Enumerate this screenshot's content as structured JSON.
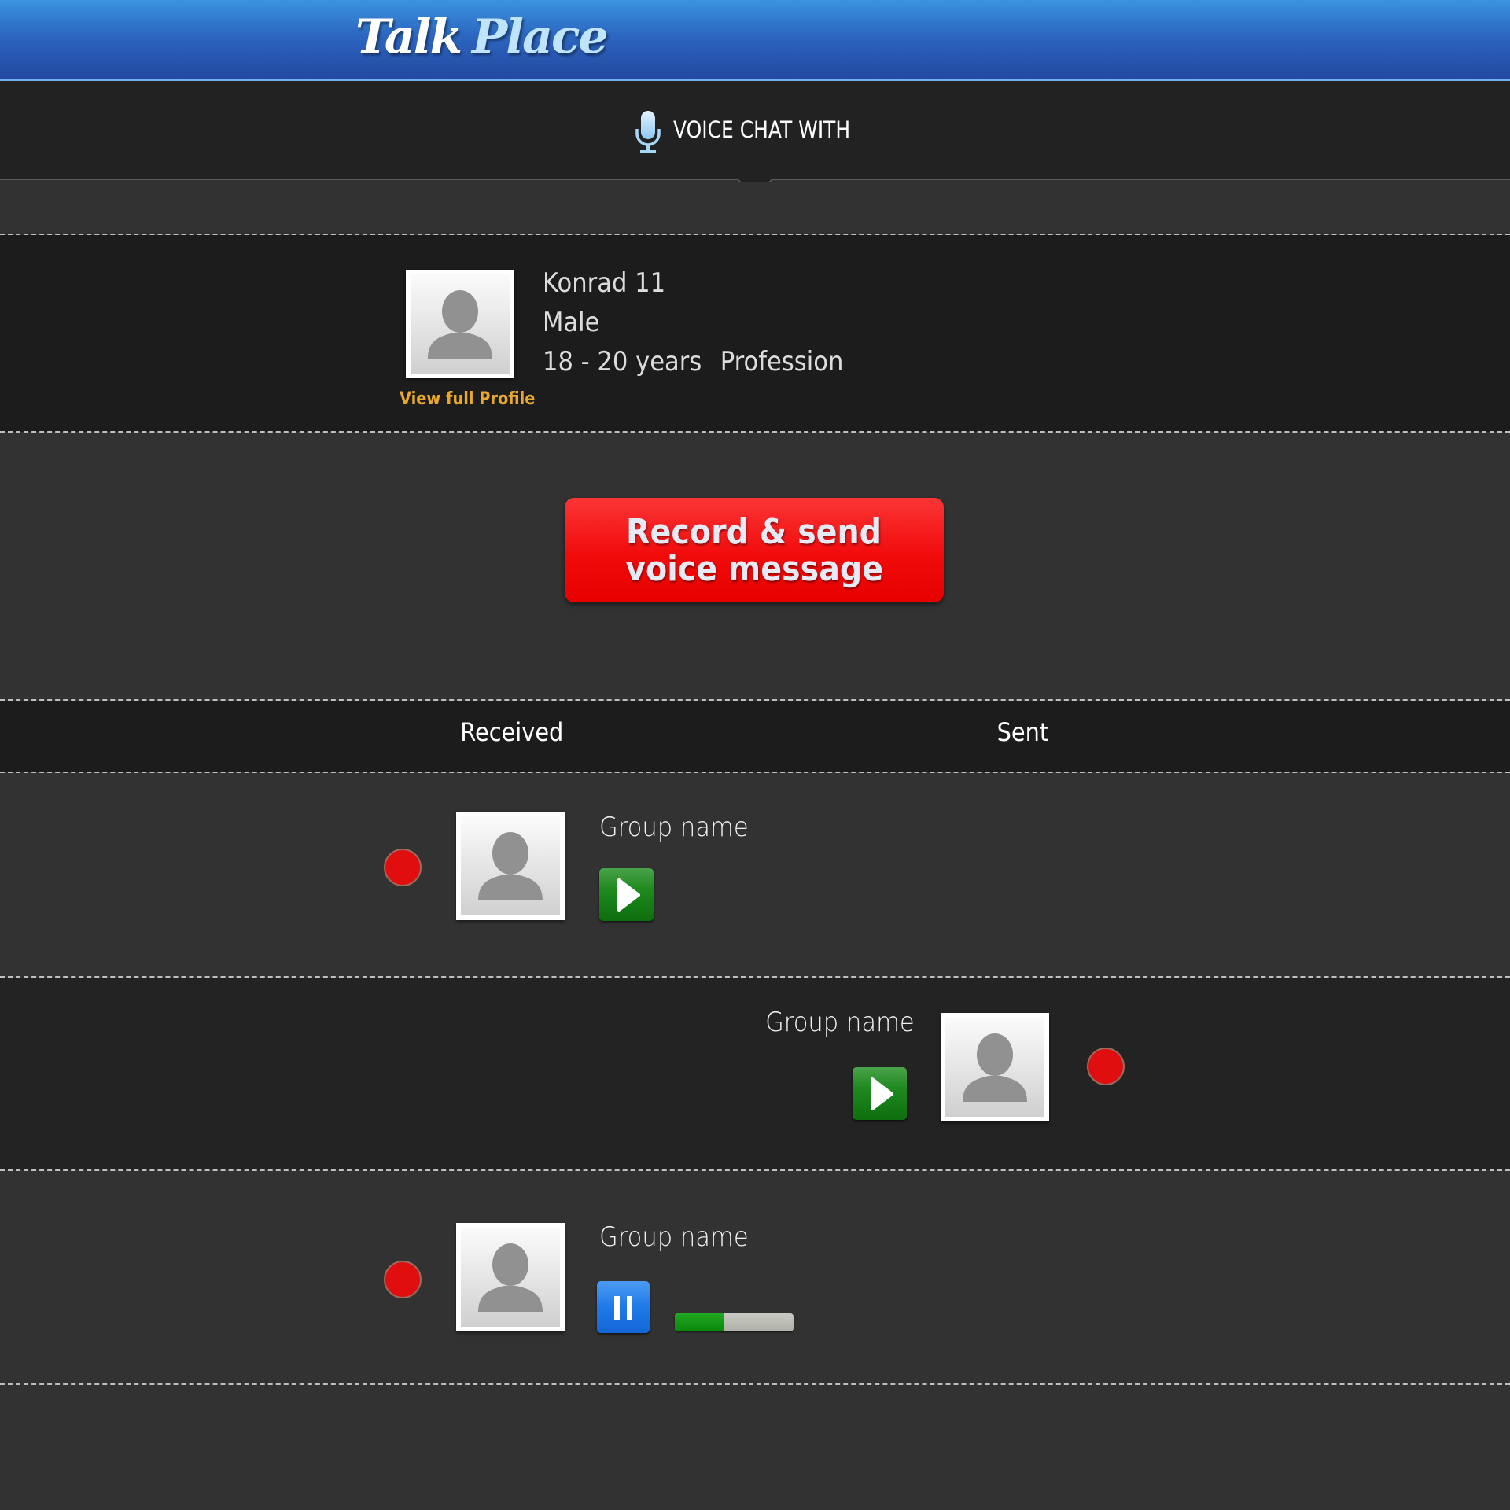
{
  "header": {
    "logo_part1": "Talk",
    "logo_part2": "Place"
  },
  "voice_chat": {
    "icon": "microphone-icon",
    "title": "VOICE CHAT WITH"
  },
  "profile": {
    "name": "Konrad 11",
    "gender": "Male",
    "age": "18 - 20 years",
    "profession": "Profession",
    "view_profile_link": "View full Profile",
    "avatar_icon": "user-placeholder-icon"
  },
  "record_button": {
    "line1": "Record & send",
    "line2": "voice message",
    "color": "#f10b0b"
  },
  "messages_header": {
    "received_label": "Received",
    "sent_label": "Sent"
  },
  "messages": [
    {
      "direction": "received",
      "group_name": "Group name",
      "control": "play",
      "control_icon": "play-icon",
      "status_icon": "unread-dot-icon"
    },
    {
      "direction": "sent",
      "group_name": "Group name",
      "control": "play",
      "control_icon": "play-icon",
      "status_icon": "unread-dot-icon"
    },
    {
      "direction": "received",
      "group_name": "Group name",
      "control": "pause",
      "control_icon": "pause-icon",
      "status_icon": "unread-dot-icon",
      "playback_progress_percent": 42
    }
  ],
  "colors": {
    "header_blue": "#2c66c0",
    "link_orange": "#e9a72e",
    "play_green": "#1f8a1f",
    "pause_blue": "#1e7ae8",
    "status_red": "#e00e0e"
  }
}
